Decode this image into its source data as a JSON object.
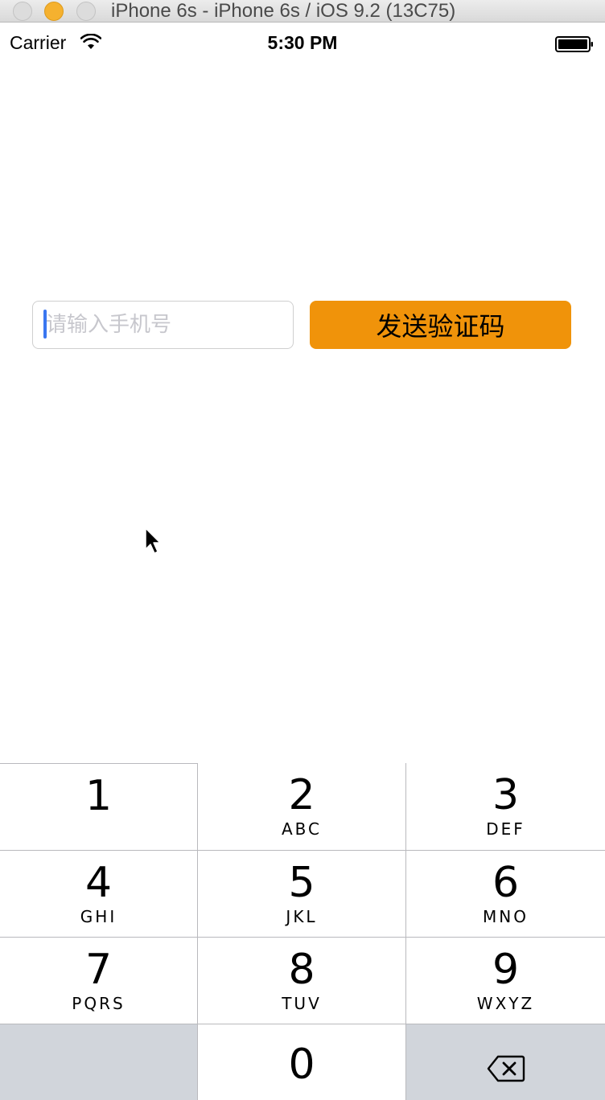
{
  "window": {
    "title": "iPhone 6s - iPhone 6s / iOS 9.2 (13C75)"
  },
  "status_bar": {
    "carrier": "Carrier",
    "time": "5:30 PM",
    "icons": [
      "wifi-icon",
      "battery-icon"
    ]
  },
  "form": {
    "phone_placeholder": "请输入手机号",
    "phone_value": "",
    "send_button_label": "发送验证码",
    "send_button_color": "#f0930a",
    "caret_color": "#3a76f0"
  },
  "keypad": {
    "keys": [
      {
        "digit": "1",
        "letters": ""
      },
      {
        "digit": "2",
        "letters": "ABC"
      },
      {
        "digit": "3",
        "letters": "DEF"
      },
      {
        "digit": "4",
        "letters": "GHI"
      },
      {
        "digit": "5",
        "letters": "JKL"
      },
      {
        "digit": "6",
        "letters": "MNO"
      },
      {
        "digit": "7",
        "letters": "PQRS"
      },
      {
        "digit": "8",
        "letters": "TUV"
      },
      {
        "digit": "9",
        "letters": "WXYZ"
      },
      {
        "digit": "0",
        "letters": ""
      }
    ],
    "delete_icon": "backspace-icon",
    "gray_key_color": "#d1d5db"
  }
}
